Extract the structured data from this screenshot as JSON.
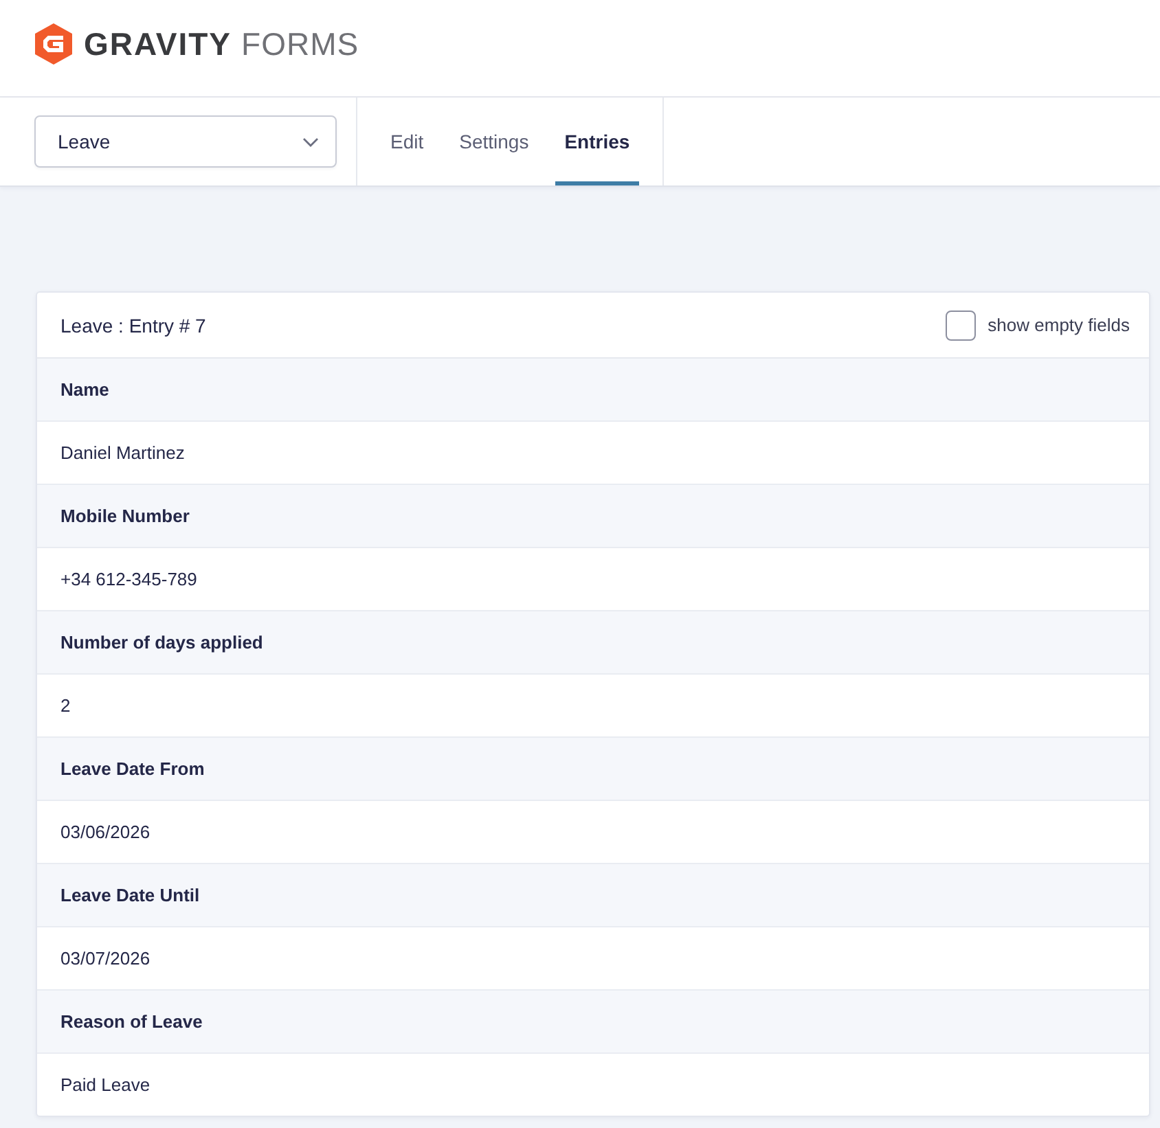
{
  "header": {
    "logo": {
      "word_1": "GRAVITY",
      "word_2": "FORMS"
    }
  },
  "toolbar": {
    "form_select": {
      "value": "Leave"
    },
    "tabs": [
      {
        "label": "Edit",
        "selected": false
      },
      {
        "label": "Settings",
        "selected": false
      },
      {
        "label": "Entries",
        "selected": true
      }
    ]
  },
  "entry": {
    "title": "Leave : Entry # 7",
    "show_empty_fields": {
      "label": "show empty fields",
      "checked": false
    },
    "fields": [
      {
        "label": "Name",
        "value": "Daniel Martinez"
      },
      {
        "label": "Mobile Number",
        "value": "+34 612-345-789"
      },
      {
        "label": "Number of days applied",
        "value": "2"
      },
      {
        "label": "Leave Date From",
        "value": "03/06/2026"
      },
      {
        "label": "Leave Date Until",
        "value": "03/07/2026"
      },
      {
        "label": "Reason of Leave",
        "value": "Paid Leave"
      }
    ]
  }
}
